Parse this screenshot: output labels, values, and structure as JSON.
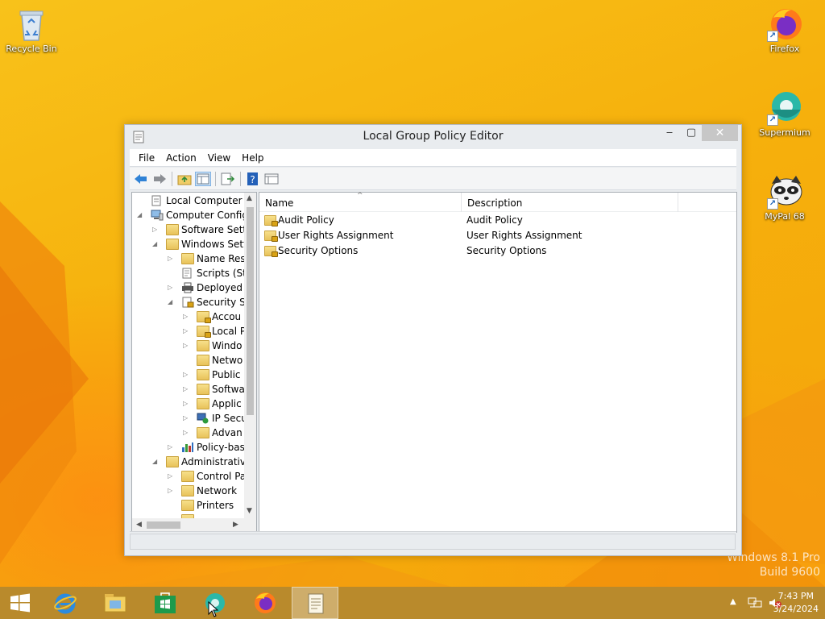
{
  "desktop": {
    "icons": [
      {
        "label": "Recycle Bin"
      },
      {
        "label": "Firefox"
      },
      {
        "label": "Supermium"
      },
      {
        "label": "MyPal 68"
      }
    ],
    "watermark": {
      "line1": "Windows 8.1 Pro",
      "line2": "Build 9600"
    }
  },
  "window": {
    "title": "Local Group Policy Editor",
    "buttons": {
      "minimize": "‒",
      "maximize": "▢",
      "close": "✕"
    },
    "menu": [
      "File",
      "Action",
      "View",
      "Help"
    ],
    "tree": [
      {
        "label": "Local Computer Polic",
        "arrow": ""
      },
      {
        "label": "Computer Config",
        "arrow": "◢"
      },
      {
        "label": "Software Setti",
        "arrow": "▷"
      },
      {
        "label": "Windows Sett",
        "arrow": "◢"
      },
      {
        "label": "Name Res",
        "arrow": "▷"
      },
      {
        "label": "Scripts (Sta",
        "arrow": ""
      },
      {
        "label": "Deployed",
        "arrow": "▷"
      },
      {
        "label": "Security Se",
        "arrow": "◢"
      },
      {
        "label": "Accou",
        "arrow": "▷"
      },
      {
        "label": "Local P",
        "arrow": "▷"
      },
      {
        "label": "Windo",
        "arrow": "▷"
      },
      {
        "label": "Netwo",
        "arrow": ""
      },
      {
        "label": "Public",
        "arrow": "▷"
      },
      {
        "label": "Softwa",
        "arrow": "▷"
      },
      {
        "label": "Applic",
        "arrow": "▷"
      },
      {
        "label": "IP Secu",
        "arrow": "▷"
      },
      {
        "label": "Advan",
        "arrow": "▷"
      },
      {
        "label": "Policy-bas",
        "arrow": "▷"
      },
      {
        "label": "Administrative",
        "arrow": "◢"
      },
      {
        "label": "Control Pa",
        "arrow": "▷"
      },
      {
        "label": "Network",
        "arrow": "▷"
      },
      {
        "label": "Printers",
        "arrow": ""
      }
    ],
    "columns": {
      "name": "Name",
      "description": "Description"
    },
    "rows": [
      {
        "name": "Audit Policy",
        "description": "Audit Policy"
      },
      {
        "name": "User Rights Assignment",
        "description": "User Rights Assignment"
      },
      {
        "name": "Security Options",
        "description": "Security Options"
      }
    ]
  },
  "taskbar": {
    "clock": {
      "time": "7:43 PM",
      "date": "3/24/2024"
    }
  }
}
